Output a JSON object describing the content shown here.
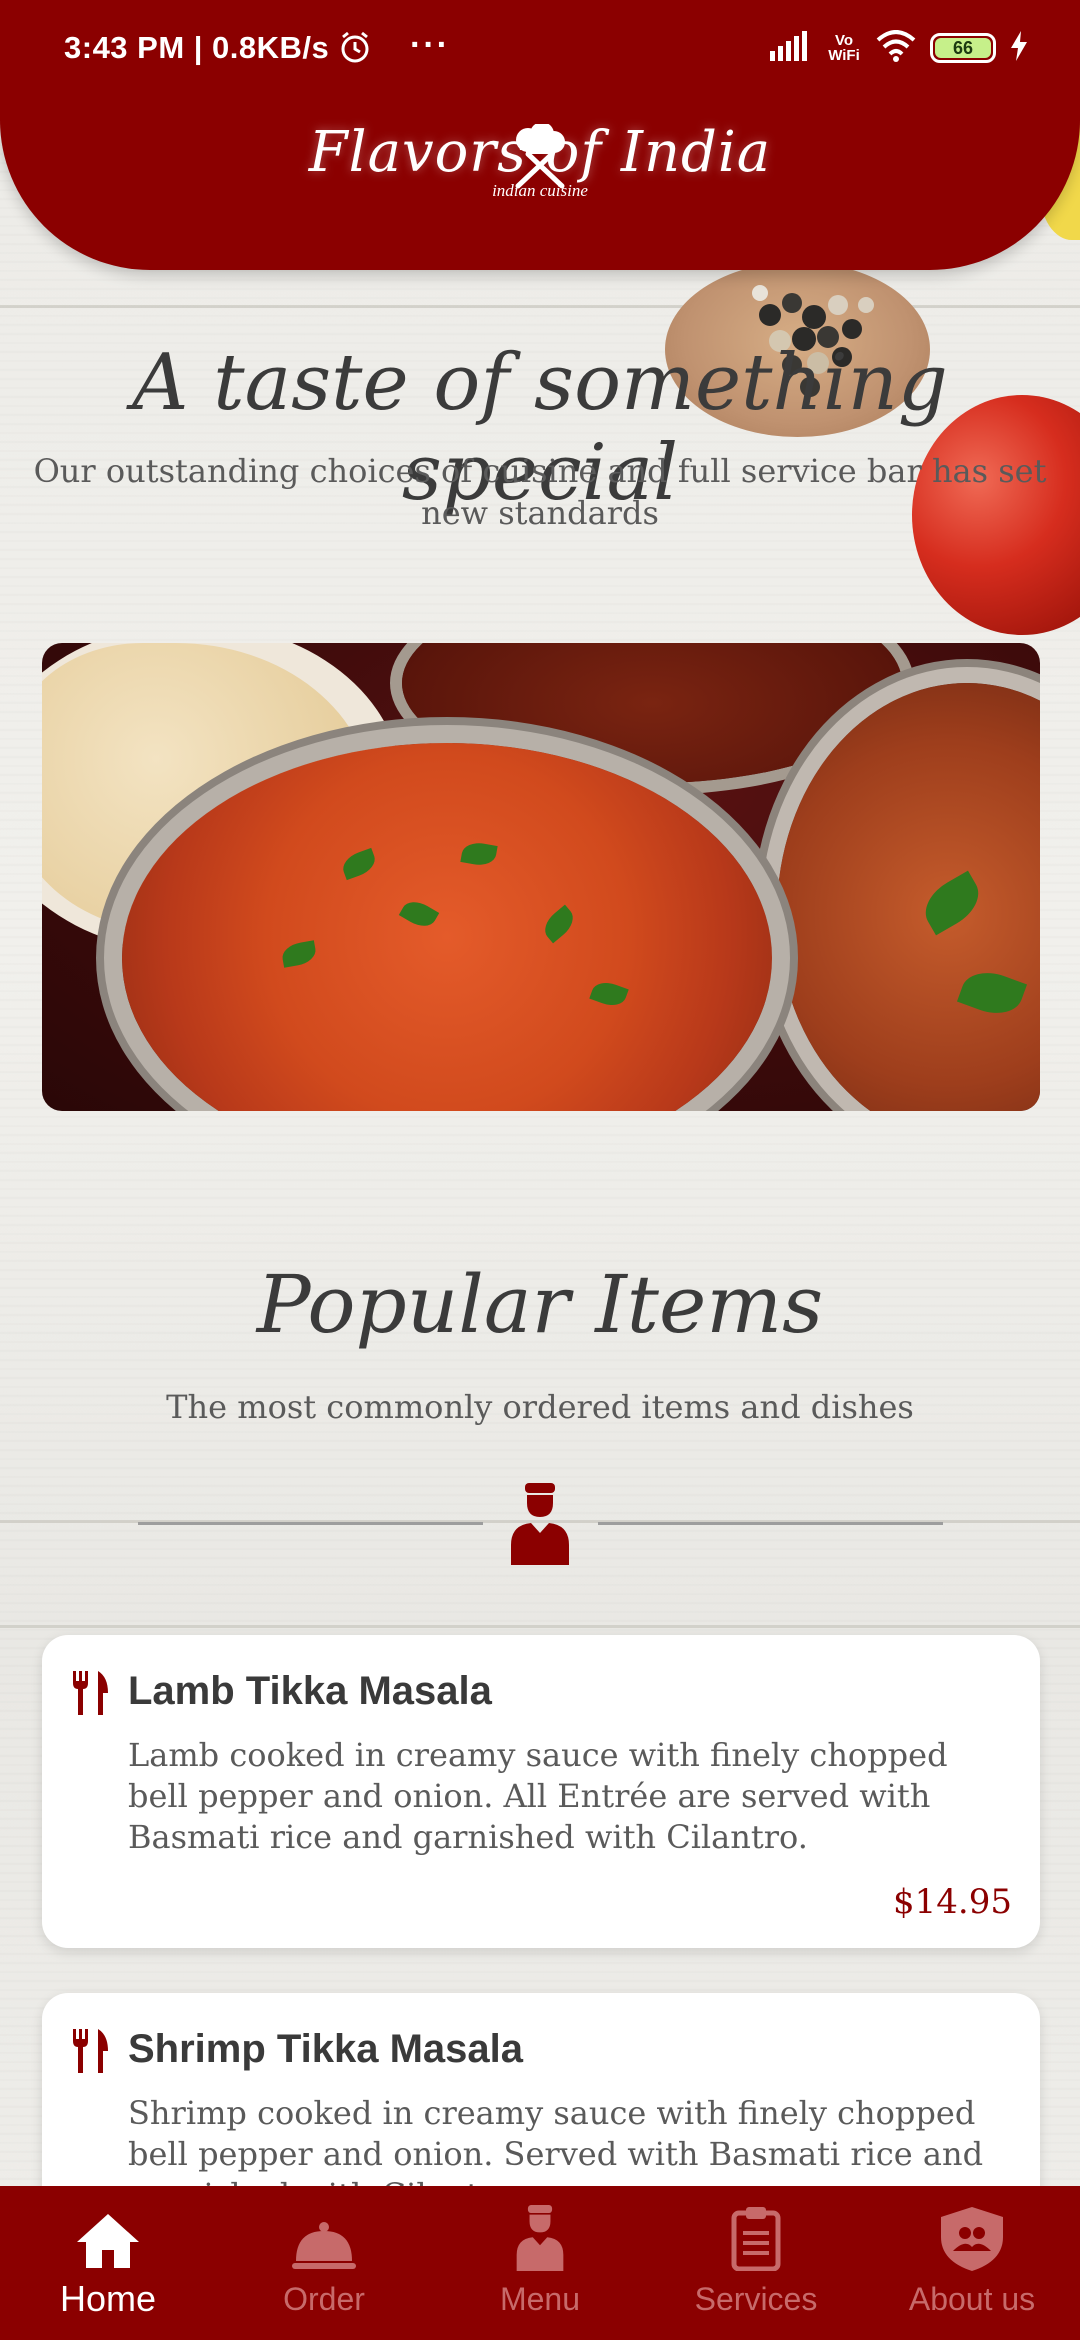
{
  "status_bar": {
    "time": "3:43 PM | 0.8KB/s",
    "more": "···",
    "volte": "Vo WiFi",
    "battery": "66"
  },
  "header": {
    "logo_text": "Flavors of India",
    "logo_sub": "indian cuisine"
  },
  "hero": {
    "title": "A taste of something special",
    "subtitle": "Our outstanding choices of cuisine and full service bar has set new standards"
  },
  "popular": {
    "title": "Popular Items",
    "subtitle": "The most commonly ordered items and dishes",
    "items": [
      {
        "name": "Lamb Tikka Masala",
        "description": "Lamb cooked in creamy sauce with finely chopped bell pepper and onion. All Entrée are served with Basmati rice and garnished with Cilantro.",
        "price": "$14.95"
      },
      {
        "name": "Shrimp Tikka Masala",
        "description": "Shrimp cooked in creamy sauce with finely chopped bell pepper and onion. Served with Basmati rice and garnished with Cilantro."
      }
    ]
  },
  "nav": {
    "items": [
      {
        "label": "Home",
        "icon": "home-icon",
        "active": true
      },
      {
        "label": "Order",
        "icon": "cloche-icon",
        "active": false
      },
      {
        "label": "Menu",
        "icon": "chef-icon",
        "active": false
      },
      {
        "label": "Services",
        "icon": "clipboard-icon",
        "active": false
      },
      {
        "label": "About us",
        "icon": "shield-people-icon",
        "active": false
      }
    ]
  },
  "colors": {
    "brand": "#8b0000",
    "nav_inactive": "#c76a6a",
    "text_dark": "#3b3b3b"
  }
}
